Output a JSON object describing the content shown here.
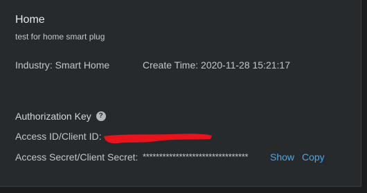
{
  "project": {
    "title": "Home",
    "description": "test for home smart plug"
  },
  "meta": {
    "industry_label": "Industry",
    "industry_value": "Smart Home",
    "create_time_label": "Create Time",
    "create_time_value": "2020-11-28 15:21:17"
  },
  "authorization": {
    "title": "Authorization Key",
    "help_icon": "question-circle-icon",
    "access_id_label": "Access ID/Client ID:",
    "access_id_redaction_color": "#e8141c",
    "secret_label": "Access Secret/Client Secret:",
    "secret_value": "********************************",
    "show_label": "Show",
    "copy_label": "Copy"
  },
  "colors": {
    "background": "#272a2c",
    "link": "#4aa8e8",
    "text": "#c4c7ca"
  }
}
